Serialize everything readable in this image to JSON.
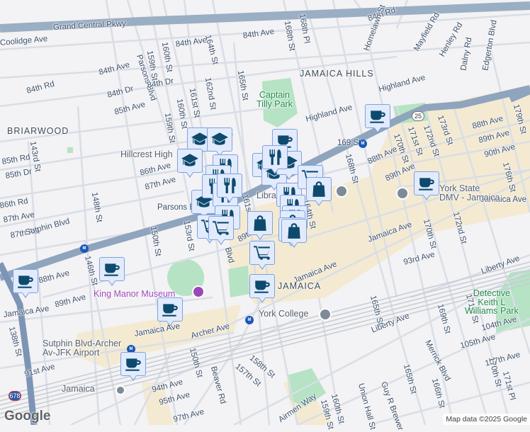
{
  "map": {
    "labels": [
      "Grand Central Pkwy",
      "84th Ave",
      "84th Ave",
      "Coolidge Ave",
      "84th Rd",
      "Homelawn St",
      "Mayfield Rd",
      "Henley Rd",
      "Dalny Rd",
      "Edgerton Blvd",
      "168th St",
      "168th Pl",
      "Parsons Blvd",
      "159th St",
      "160th St",
      "164th St",
      "165th St",
      "161st St",
      "162nd St",
      "160th St",
      "159th St",
      "84th Ave",
      "84th Rd",
      "84th Dr",
      "85th Ave",
      "84th Dr",
      "Highland Ave",
      "Highland Ave",
      "143rd St",
      "86th Ave",
      "87th Ave",
      "85th Rd",
      "85th Dr",
      "86th Rd",
      "87th Ave",
      "87th Rd",
      "Parsons Blvd",
      "148th St",
      "150th St",
      "153rd St",
      "169 St",
      "88th Ave",
      "89th Ave",
      "170th St",
      "171st St",
      "172nd St",
      "173rd St",
      "88th Ave",
      "89th Ave",
      "90th Ave",
      "176th St",
      "179th St",
      "168th St",
      "164th St",
      "170th St",
      "172nd St",
      "Jamaica Ave",
      "93rd Ave",
      "Jamaica Ave",
      "Sutphin Blvd",
      "146th St",
      "88th Ave",
      "89th Ave",
      "Jamaica Ave",
      "Jamaica Ave",
      "Archer Ave",
      "138th St",
      "91st Ave",
      "Liberty Ave",
      "165th St",
      "158th St",
      "157th St",
      "150th St",
      "Beaver Rd",
      "94th Ave",
      "95th Ave",
      "97th Ave",
      "Merrick Blvd",
      "169th St",
      "171st St",
      "104th Ave",
      "105th Ave",
      "107th Ave",
      "170th St",
      "171st Pl",
      "Guy R Brewer",
      "Union Hall St",
      "160th St",
      "159th St",
      "Airmen Way",
      "165th St",
      "166th St",
      "Jamaica Ave",
      "Liberty Ave",
      "161st St",
      "89th Ave",
      "Blvd"
    ],
    "areas": [
      "JAMAICA HILLS",
      "BRIARWOOD",
      "JAMAICA"
    ],
    "parks": [
      "Captain\nTilly Park",
      "Detective\nKeith L\nWilliams Park"
    ],
    "pois": [
      "Hillcrest High",
      "Library",
      "York State\nDMV - Jamaica",
      "York College",
      "Sutphin Blvd-Archer\nAv-JFK Airport",
      "Jamaica"
    ],
    "museum": "King Manor Museum",
    "shields": [
      "25",
      "678"
    ],
    "subway_badge": "M",
    "markers": [
      "coffee",
      "coffee",
      "coffee",
      "coffee",
      "coffee",
      "coffee",
      "coffee",
      "coffee",
      "school",
      "school",
      "school",
      "school",
      "school",
      "school",
      "school",
      "restaurant",
      "restaurant",
      "restaurant",
      "restaurant",
      "restaurant",
      "restaurant",
      "restaurant",
      "restaurant",
      "restaurant",
      "restaurant",
      "cart",
      "cart",
      "cart",
      "cart",
      "bag",
      "bag",
      "bag",
      "bag",
      "bag"
    ]
  },
  "footer": {
    "logo": "Google",
    "attribution": "Map data ©2025 Google"
  },
  "colors": {
    "marker_bg": "#e2ebfc",
    "marker_border": "#7fa1e0",
    "icon": "#0d4a6e",
    "highway": "#8fa4bd"
  }
}
